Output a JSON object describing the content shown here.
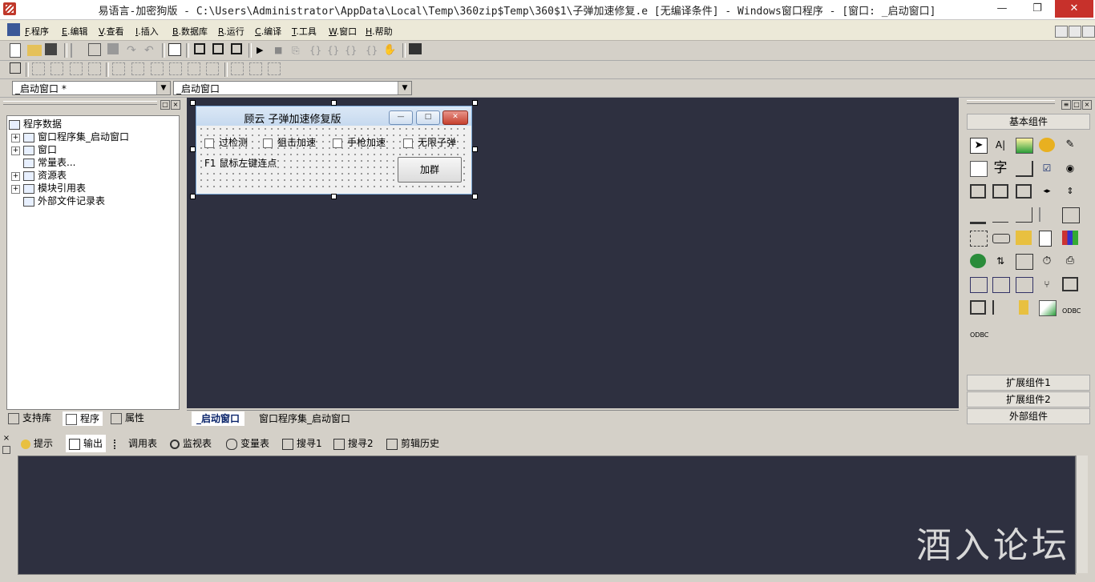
{
  "titlebar": {
    "title": "易语言-加密狗版 - C:\\Users\\Administrator\\AppData\\Local\\Temp\\360zip$Temp\\360$1\\子弹加速修复.e [无编译条件] - Windows窗口程序 - [窗口: _启动窗口]",
    "minimize": "—",
    "restore": "❐",
    "close": "✕"
  },
  "menu": [
    {
      "key": "F",
      "label": ".程序"
    },
    {
      "key": "E",
      "label": ".编辑"
    },
    {
      "key": "V",
      "label": ".查看"
    },
    {
      "key": "I",
      "label": ".插入"
    },
    {
      "key": "B",
      "label": ".数据库"
    },
    {
      "key": "R",
      "label": ".运行"
    },
    {
      "key": "C",
      "label": ".编译"
    },
    {
      "key": "T",
      "label": ".工具"
    },
    {
      "key": "W",
      "label": ".窗口"
    },
    {
      "key": "H",
      "label": ".帮助"
    }
  ],
  "combos": {
    "left": "_启动窗口 *",
    "right": "_启动窗口"
  },
  "tree": {
    "root": "程序数据",
    "items": [
      "窗口程序集_启动窗口",
      "窗口",
      "常量表...",
      "资源表",
      "模块引用表",
      "外部文件记录表"
    ]
  },
  "left_tabs": [
    "支持库",
    "程序",
    "属性"
  ],
  "design_window": {
    "title": "顾云 子弹加速修复版",
    "checkboxes": [
      "过检测",
      "狙击加速",
      "手枪加速",
      "无限子弹"
    ],
    "label": "F1 鼠标左键连点",
    "button": "加群"
  },
  "editor_tabs": [
    "_启动窗口",
    "窗口程序集_启动窗口"
  ],
  "palette": {
    "basic": "基本组件",
    "ext1": "扩展组件1",
    "ext2": "扩展组件2",
    "external": "外部组件"
  },
  "bottom_tabs": [
    "提示",
    "输出",
    "调用表",
    "监视表",
    "变量表",
    "搜寻1",
    "搜寻2",
    "剪辑历史"
  ],
  "watermark": "酒入论坛"
}
